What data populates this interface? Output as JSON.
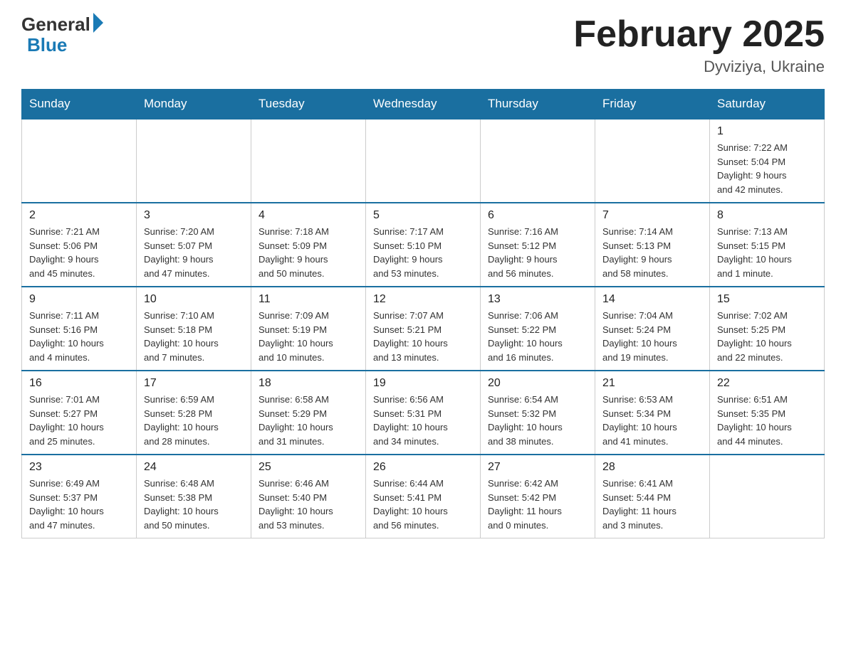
{
  "header": {
    "logo_general": "General",
    "logo_blue": "Blue",
    "month_title": "February 2025",
    "location": "Dyviziya, Ukraine"
  },
  "weekdays": [
    "Sunday",
    "Monday",
    "Tuesday",
    "Wednesday",
    "Thursday",
    "Friday",
    "Saturday"
  ],
  "weeks": [
    [
      {
        "day": "",
        "info": ""
      },
      {
        "day": "",
        "info": ""
      },
      {
        "day": "",
        "info": ""
      },
      {
        "day": "",
        "info": ""
      },
      {
        "day": "",
        "info": ""
      },
      {
        "day": "",
        "info": ""
      },
      {
        "day": "1",
        "info": "Sunrise: 7:22 AM\nSunset: 5:04 PM\nDaylight: 9 hours\nand 42 minutes."
      }
    ],
    [
      {
        "day": "2",
        "info": "Sunrise: 7:21 AM\nSunset: 5:06 PM\nDaylight: 9 hours\nand 45 minutes."
      },
      {
        "day": "3",
        "info": "Sunrise: 7:20 AM\nSunset: 5:07 PM\nDaylight: 9 hours\nand 47 minutes."
      },
      {
        "day": "4",
        "info": "Sunrise: 7:18 AM\nSunset: 5:09 PM\nDaylight: 9 hours\nand 50 minutes."
      },
      {
        "day": "5",
        "info": "Sunrise: 7:17 AM\nSunset: 5:10 PM\nDaylight: 9 hours\nand 53 minutes."
      },
      {
        "day": "6",
        "info": "Sunrise: 7:16 AM\nSunset: 5:12 PM\nDaylight: 9 hours\nand 56 minutes."
      },
      {
        "day": "7",
        "info": "Sunrise: 7:14 AM\nSunset: 5:13 PM\nDaylight: 9 hours\nand 58 minutes."
      },
      {
        "day": "8",
        "info": "Sunrise: 7:13 AM\nSunset: 5:15 PM\nDaylight: 10 hours\nand 1 minute."
      }
    ],
    [
      {
        "day": "9",
        "info": "Sunrise: 7:11 AM\nSunset: 5:16 PM\nDaylight: 10 hours\nand 4 minutes."
      },
      {
        "day": "10",
        "info": "Sunrise: 7:10 AM\nSunset: 5:18 PM\nDaylight: 10 hours\nand 7 minutes."
      },
      {
        "day": "11",
        "info": "Sunrise: 7:09 AM\nSunset: 5:19 PM\nDaylight: 10 hours\nand 10 minutes."
      },
      {
        "day": "12",
        "info": "Sunrise: 7:07 AM\nSunset: 5:21 PM\nDaylight: 10 hours\nand 13 minutes."
      },
      {
        "day": "13",
        "info": "Sunrise: 7:06 AM\nSunset: 5:22 PM\nDaylight: 10 hours\nand 16 minutes."
      },
      {
        "day": "14",
        "info": "Sunrise: 7:04 AM\nSunset: 5:24 PM\nDaylight: 10 hours\nand 19 minutes."
      },
      {
        "day": "15",
        "info": "Sunrise: 7:02 AM\nSunset: 5:25 PM\nDaylight: 10 hours\nand 22 minutes."
      }
    ],
    [
      {
        "day": "16",
        "info": "Sunrise: 7:01 AM\nSunset: 5:27 PM\nDaylight: 10 hours\nand 25 minutes."
      },
      {
        "day": "17",
        "info": "Sunrise: 6:59 AM\nSunset: 5:28 PM\nDaylight: 10 hours\nand 28 minutes."
      },
      {
        "day": "18",
        "info": "Sunrise: 6:58 AM\nSunset: 5:29 PM\nDaylight: 10 hours\nand 31 minutes."
      },
      {
        "day": "19",
        "info": "Sunrise: 6:56 AM\nSunset: 5:31 PM\nDaylight: 10 hours\nand 34 minutes."
      },
      {
        "day": "20",
        "info": "Sunrise: 6:54 AM\nSunset: 5:32 PM\nDaylight: 10 hours\nand 38 minutes."
      },
      {
        "day": "21",
        "info": "Sunrise: 6:53 AM\nSunset: 5:34 PM\nDaylight: 10 hours\nand 41 minutes."
      },
      {
        "day": "22",
        "info": "Sunrise: 6:51 AM\nSunset: 5:35 PM\nDaylight: 10 hours\nand 44 minutes."
      }
    ],
    [
      {
        "day": "23",
        "info": "Sunrise: 6:49 AM\nSunset: 5:37 PM\nDaylight: 10 hours\nand 47 minutes."
      },
      {
        "day": "24",
        "info": "Sunrise: 6:48 AM\nSunset: 5:38 PM\nDaylight: 10 hours\nand 50 minutes."
      },
      {
        "day": "25",
        "info": "Sunrise: 6:46 AM\nSunset: 5:40 PM\nDaylight: 10 hours\nand 53 minutes."
      },
      {
        "day": "26",
        "info": "Sunrise: 6:44 AM\nSunset: 5:41 PM\nDaylight: 10 hours\nand 56 minutes."
      },
      {
        "day": "27",
        "info": "Sunrise: 6:42 AM\nSunset: 5:42 PM\nDaylight: 11 hours\nand 0 minutes."
      },
      {
        "day": "28",
        "info": "Sunrise: 6:41 AM\nSunset: 5:44 PM\nDaylight: 11 hours\nand 3 minutes."
      },
      {
        "day": "",
        "info": ""
      }
    ]
  ]
}
